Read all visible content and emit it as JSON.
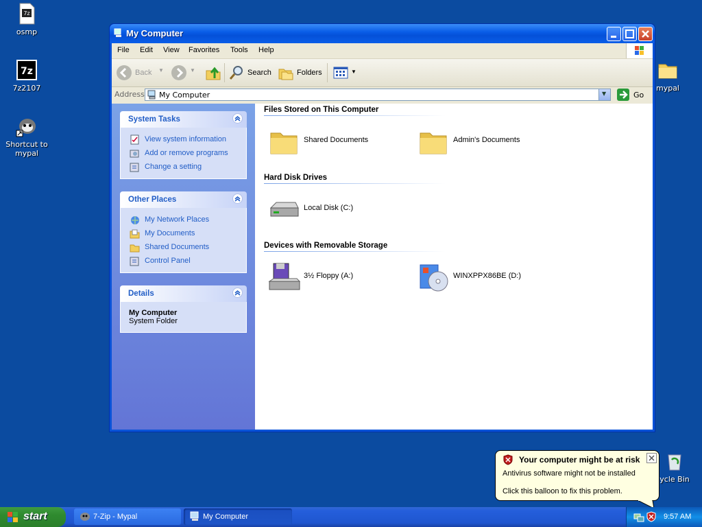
{
  "desktop": {
    "icons": [
      {
        "label": "osmp"
      },
      {
        "label": "7z2107"
      },
      {
        "label": "Shortcut to\nmypal"
      },
      {
        "label": "mypal"
      },
      {
        "label": "ycle Bin"
      }
    ]
  },
  "window": {
    "title": "My Computer",
    "menu": [
      "File",
      "Edit",
      "View",
      "Favorites",
      "Tools",
      "Help"
    ],
    "toolbar": {
      "back": "Back",
      "search": "Search",
      "folders": "Folders"
    },
    "address": {
      "label": "Address",
      "value": "My Computer",
      "go": "Go"
    },
    "left_pane": {
      "system_tasks": {
        "title": "System Tasks",
        "items": [
          "View system information",
          "Add or remove programs",
          "Change a setting"
        ]
      },
      "other_places": {
        "title": "Other Places",
        "items": [
          "My Network Places",
          "My Documents",
          "Shared Documents",
          "Control Panel"
        ]
      },
      "details": {
        "title": "Details",
        "name": "My Computer",
        "type": "System Folder"
      }
    },
    "sections": [
      {
        "title": "Files Stored on This Computer",
        "items": [
          "Shared Documents",
          "Admin's Documents"
        ]
      },
      {
        "title": "Hard Disk Drives",
        "items": [
          "Local Disk (C:)"
        ]
      },
      {
        "title": "Devices with Removable Storage",
        "items": [
          "3½ Floppy (A:)",
          "WINXPPX86BE (D:)"
        ]
      }
    ]
  },
  "balloon": {
    "title": "Your computer might be at risk",
    "line1": "Antivirus software might not be installed",
    "line2": "Click this balloon to fix this problem."
  },
  "taskbar": {
    "start": "start",
    "tasks": [
      "7-Zip - Mypal",
      "My Computer"
    ],
    "clock": "9:57 AM"
  },
  "colors": {
    "desktop": "#0b4ba0",
    "titlebar": "#0a5ee8",
    "link": "#215dc6",
    "start_green": "#2f8a2f"
  }
}
